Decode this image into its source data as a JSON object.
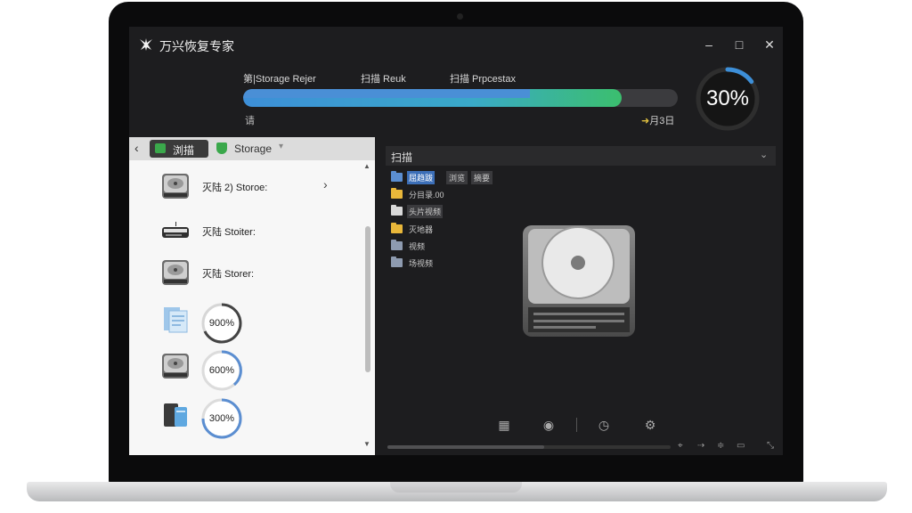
{
  "app": {
    "title": "万兴恢复专家",
    "window_controls": {
      "minimize": "–",
      "maximize": "□",
      "close": "✕"
    }
  },
  "scan": {
    "labels": [
      "第|Storage Rejer",
      "扫描 Reuk",
      "扫描 Prpcestax"
    ],
    "progress_percent": 30,
    "progress_text": "30%",
    "bar_primary_fraction": 0.87,
    "bar_secondary_fraction": 0.66,
    "below_left": "请",
    "below_right": "月3日",
    "below_right_icon": "arrow-icon"
  },
  "left_panel": {
    "back_icon": "chevron-left-icon",
    "chip_label": "浏描",
    "storage_label": "Storage",
    "rows": [
      {
        "label": "灭陆 2) Storoe:",
        "icon": "hard-drive-icon",
        "has_chevron": true
      },
      {
        "label": "灭陆 Stoiter:",
        "icon": "dvd-drive-icon"
      },
      {
        "label": "灭陆 Storer:",
        "icon": "hard-drive-icon"
      },
      {
        "ring_text": "900%",
        "icon": "document-icon"
      },
      {
        "ring_text": "600%",
        "icon": "hard-drive-icon"
      },
      {
        "ring_text": "300%",
        "icon": "usb-drive-icon"
      }
    ]
  },
  "right_panel": {
    "title": "扫描",
    "files": [
      {
        "label": "屈趋跋",
        "tags": [
          "浏览",
          "摘要"
        ],
        "color": "#5b8ed1",
        "selected": true
      },
      {
        "label": "分目录.00",
        "color": "#e9b73a"
      },
      {
        "label": "头片视频",
        "color": "#d9d9d9",
        "boxed": true
      },
      {
        "label": "灭地器",
        "color": "#e9b73a"
      },
      {
        "label": "视频",
        "color": "#8e9bb0"
      },
      {
        "label": "场视频",
        "color": "#8e9bb0"
      }
    ],
    "toolbar_icons": [
      "calendar-icon",
      "globe-icon",
      "clock-icon",
      "gear-icon"
    ],
    "bottom_icons": [
      "pin-icon",
      "recover-icon",
      "filter-icon",
      "preview-icon",
      "expand-icon"
    ]
  },
  "colors": {
    "accent_blue": "#3d8fd8",
    "accent_green": "#3bbf6e",
    "screen_bg": "#1d1d1f"
  }
}
